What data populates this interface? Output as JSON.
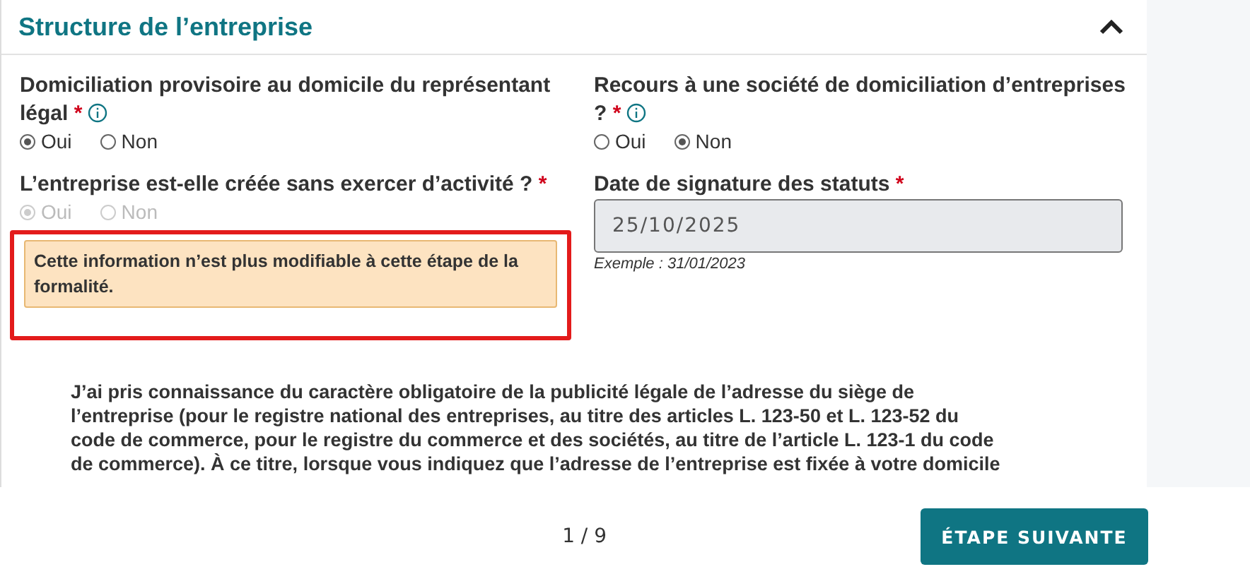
{
  "section": {
    "title": "Structure de l’entreprise",
    "expanded": true
  },
  "fields": [
    {
      "kind": "radio",
      "label": "Domiciliation provisoire au domicile du représentant légal",
      "required_mark": "*",
      "info": true,
      "disabled": false,
      "options": [
        {
          "label": "Oui",
          "selected": true
        },
        {
          "label": "Non",
          "selected": false
        }
      ]
    },
    {
      "kind": "radio",
      "label": "Recours à une société de domiciliation d’entreprises ?",
      "required_mark": "*",
      "info": true,
      "disabled": false,
      "options": [
        {
          "label": "Oui",
          "selected": false
        },
        {
          "label": "Non",
          "selected": true
        }
      ]
    },
    {
      "kind": "radio",
      "label": "L’entreprise est-elle créée sans exercer d’activité ?",
      "required_mark": "*",
      "info": false,
      "disabled": true,
      "options": [
        {
          "label": "Oui",
          "selected": true
        },
        {
          "label": "Non",
          "selected": false
        }
      ],
      "warning": "Cette information n’est plus modifiable à cette étape de la formalité.",
      "highlighted": true
    },
    {
      "kind": "date",
      "label": "Date de signature des statuts",
      "required_mark": "*",
      "info": false,
      "disabled": true,
      "value": "25/10/2025",
      "hint": "Exemple : 31/01/2023"
    }
  ],
  "notice": [
    "J’ai pris connaissance du caractère obligatoire de la publicité légale de l’adresse du siège de",
    "l’entreprise (pour le registre national des entreprises, au titre des articles L. 123-50 et L. 123-52 du",
    "code de commerce, pour le registre du commerce et des sociétés, au titre de l’article L. 123-1 du code",
    "de commerce). À ce titre, lorsque vous indiquez que l’adresse de l’entreprise est fixée à votre domicile"
  ],
  "footer": {
    "page": "1 / 9",
    "next": "ÉTAPE SUIVANTE"
  }
}
